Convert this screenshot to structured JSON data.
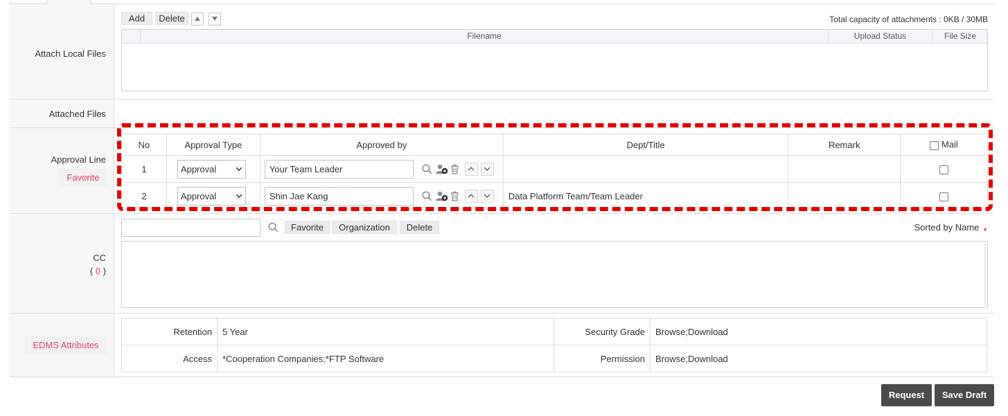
{
  "attach": {
    "label": "Attach Local Files",
    "add_label": "Add",
    "delete_label": "Delete",
    "capacity_text": "Total capacity of attachments : 0KB / 30MB",
    "columns": {
      "filename": "Filename",
      "upload_status": "Upload Status",
      "file_size": "File Size"
    }
  },
  "attached_files": {
    "label": "Attached Files"
  },
  "approval": {
    "label": "Approval Line",
    "favorite_label": "Favorite",
    "columns": {
      "no": "No",
      "type": "Approval Type",
      "approved_by": "Approved by",
      "dept": "Dept/Title",
      "remark": "Remark",
      "mail": "Mail"
    },
    "rows": [
      {
        "no": "1",
        "type": "Approval",
        "approved_by": "Your Team Leader",
        "dept": "",
        "remark": ""
      },
      {
        "no": "2",
        "type": "Approval",
        "approved_by": "Shin Jae Kang",
        "dept": "Data Platform Team/Team Leader",
        "remark": ""
      }
    ]
  },
  "cc": {
    "label": "CC",
    "count": "0",
    "favorite_label": "Favorite",
    "organization_label": "Organization",
    "delete_label": "Delete",
    "sort_label": "Sorted by Name"
  },
  "edms": {
    "label": "EDMS Attributes",
    "retention_key": "Retention",
    "retention_value": "5 Year",
    "security_key": "Security Grade",
    "security_value": "Browse;Download",
    "access_key": "Access",
    "access_value": "*Cooperation Companies;*FTP Software",
    "permission_key": "Permission",
    "permission_value": "Browse;Download"
  },
  "footer": {
    "request_label": "Request",
    "save_draft_label": "Save Draft"
  },
  "colors": {
    "accent_pink": "#e6436b",
    "highlight_red": "#e40000",
    "dark_button": "#4a4a4a"
  }
}
